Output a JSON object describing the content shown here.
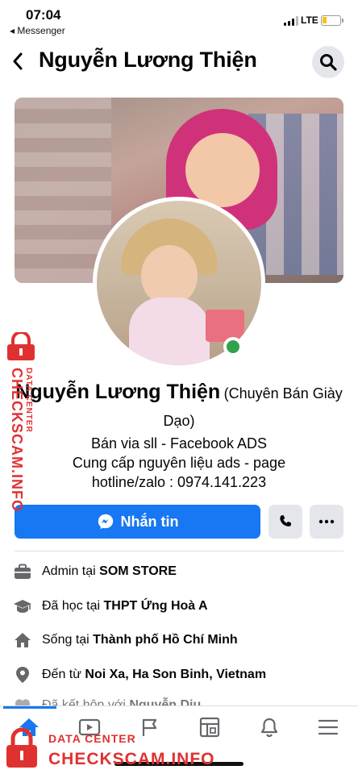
{
  "status_bar": {
    "time": "07:04",
    "back_app": "◂ Messenger",
    "network": "LTE"
  },
  "header": {
    "title": "Nguyễn Lương Thiện",
    "back_icon": "chevron-left-icon",
    "search_icon": "search-icon"
  },
  "profile": {
    "name": "Nguyễn Lương Thiện",
    "alternate_name": "(Chuyên Bán Giày Dạo)",
    "online": true,
    "bio": [
      "Bán via sll  - Facebook ADS",
      "Cung cấp nguyên liệu ads - page",
      "hotline/zalo : 0974.141.223"
    ]
  },
  "actions": {
    "message_label": "Nhắn tin",
    "message_icon": "messenger-icon",
    "call_icon": "phone-icon",
    "more_icon": "more-horizontal-icon"
  },
  "details": [
    {
      "icon": "briefcase-icon",
      "prefix": "Admin tại ",
      "value": "SOM STORE"
    },
    {
      "icon": "graduation-cap-icon",
      "prefix": "Đã học tại ",
      "value": "THPT Ứng Hoà A"
    },
    {
      "icon": "home-icon",
      "prefix": "Sống tại ",
      "value": "Thành phố Hồ Chí Minh"
    },
    {
      "icon": "location-pin-icon",
      "prefix": "Đến từ ",
      "value": "Noi Xa, Ha Son Binh, Vietnam"
    },
    {
      "icon": "heart-icon",
      "prefix": "Đã kết hôn với ",
      "value": "Nguyễn Diu"
    }
  ],
  "tabbar": {
    "tabs": [
      "home-icon",
      "video-icon",
      "flag-icon",
      "marketplace-icon",
      "bell-icon",
      "menu-icon"
    ],
    "active": "home-icon"
  },
  "watermark": {
    "side_main": "CHECKSCAM.INFO",
    "side_small": "DATA CENTER",
    "bottom_line1": "DATA CENTER",
    "bottom_line2": "CHECKSCAM.INFO"
  },
  "colors": {
    "accent": "#1877f2",
    "online": "#31a24c",
    "watermark": "#e03131"
  }
}
